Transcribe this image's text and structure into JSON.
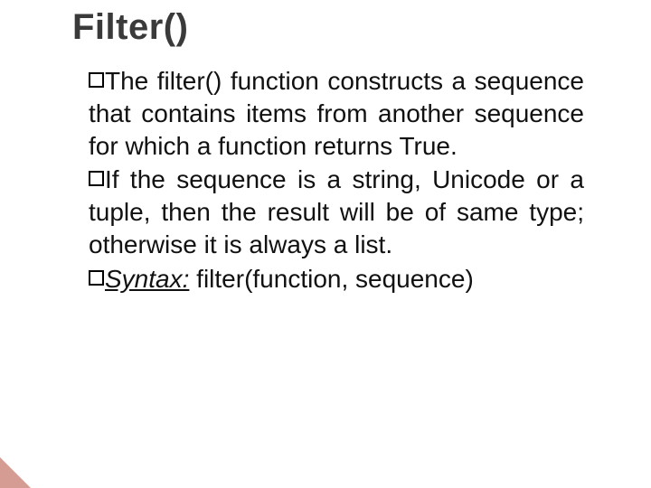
{
  "title": "Filter()",
  "bullets": [
    {
      "lead": "The",
      "rest": "filter() function constructs a sequence that contains items from another sequence for which a function returns True."
    },
    {
      "lead": "If",
      "rest": "the sequence is a string, Unicode or a tuple, then the result will be of same type; otherwise it is always a list."
    }
  ],
  "syntax": {
    "label": "Syntax:",
    "value": "filter(function, sequence)"
  }
}
